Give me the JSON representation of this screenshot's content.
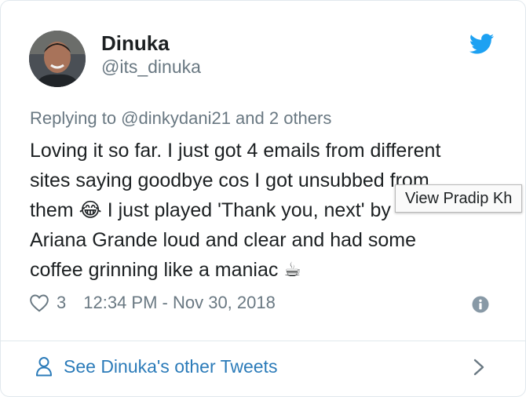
{
  "author": {
    "name": "Dinuka",
    "handle": "@its_dinuka"
  },
  "reply_context": "Replying to @dinkydani21 and 2 others",
  "tweet_lines": [
    "Loving it so far. I just got 4 emails from different",
    "sites saying goodbye cos I got unsubbed from",
    "I just played 'Thank you, next' by",
    "Ariana Grande loud and clear and had some",
    "coffee grinning like a maniac"
  ],
  "tweet_fragment_them": "them",
  "emojis": {
    "tears_of_joy": "😂",
    "hot_beverage": "☕"
  },
  "tooltip": "View Pradip Kh",
  "meta": {
    "likes": "3",
    "timestamp": "12:34 PM - Nov 30, 2018"
  },
  "footer": {
    "link_label": "See Dinuka's other Tweets"
  },
  "icons": {
    "brand": "twitter-bird-icon",
    "like": "heart-icon",
    "info": "info-icon",
    "profile": "person-icon",
    "more": "chevron-right-icon"
  },
  "colors": {
    "brand_blue": "#1da1f2",
    "link_blue": "#2b7bb9",
    "secondary_text": "#697882",
    "primary_text": "#1c2022",
    "border": "#e1e8ed"
  }
}
